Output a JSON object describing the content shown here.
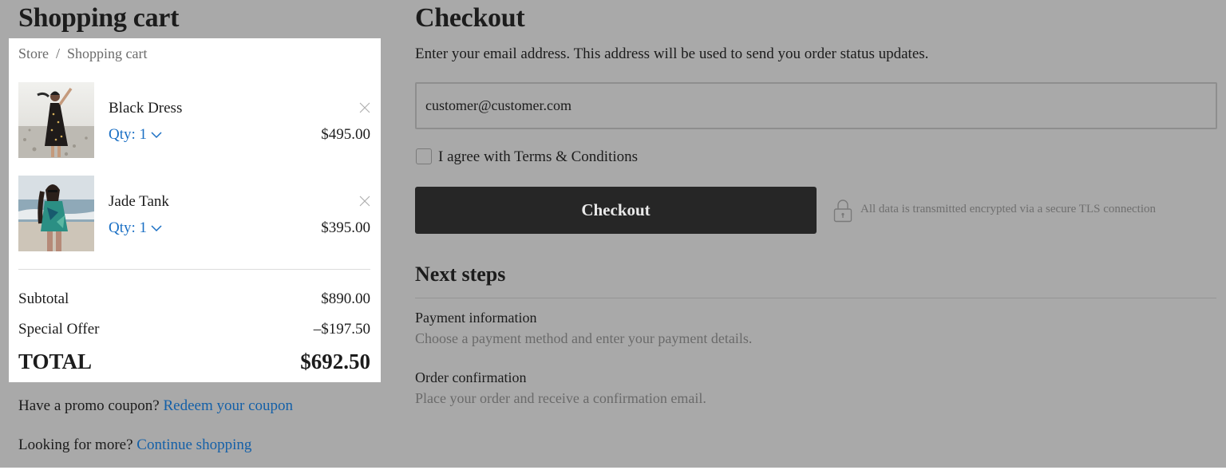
{
  "cart": {
    "title": "Shopping cart",
    "breadcrumb": {
      "store": "Store",
      "separator": "/",
      "current": "Shopping cart"
    },
    "items": [
      {
        "name": "Black Dress",
        "qty_label": "Qty: 1",
        "price": "$495.00",
        "image_icon": "black-dress-photo"
      },
      {
        "name": "Jade Tank",
        "qty_label": "Qty: 1",
        "price": "$395.00",
        "image_icon": "jade-tank-photo"
      }
    ],
    "summary": {
      "subtotal_label": "Subtotal",
      "subtotal_value": "$890.00",
      "offer_label": "Special Offer",
      "offer_value": "–$197.50",
      "total_label": "TOTAL",
      "total_value": "$692.50"
    },
    "promo": {
      "text": "Have a promo coupon?",
      "link": "Redeem your coupon"
    },
    "more": {
      "text": "Looking for more?",
      "link": "Continue shopping"
    }
  },
  "checkout": {
    "title": "Checkout",
    "email_hint": "Enter your email address. This address will be used to send you order status updates.",
    "email_value": "customer@customer.com",
    "terms_label": "I agree with Terms & Conditions",
    "button_label": "Checkout",
    "secure_note": "All data is transmitted encrypted via a secure TLS connection",
    "next_steps": {
      "title": "Next steps",
      "steps": [
        {
          "title": "Payment information",
          "desc": "Choose a payment method and enter your payment details."
        },
        {
          "title": "Order confirmation",
          "desc": "Place your order and receive a confirmation email."
        }
      ]
    }
  },
  "colors": {
    "background": "#a9a9a9",
    "panel": "#ffffff",
    "link": "#1a6fc4",
    "button": "#262626"
  }
}
